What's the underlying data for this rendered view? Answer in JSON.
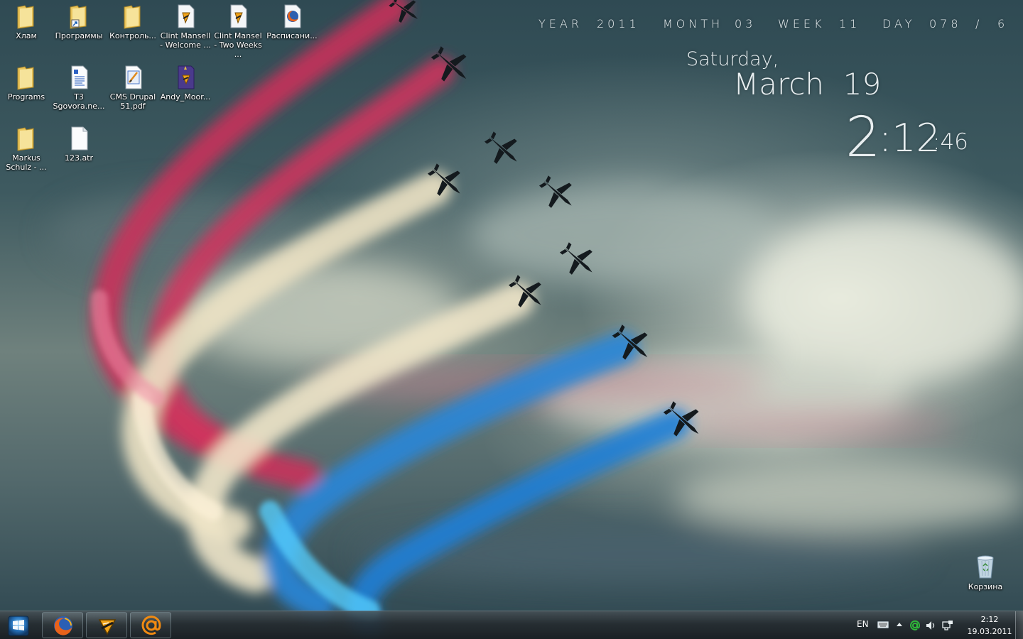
{
  "desktop": {
    "icons": [
      {
        "label": "Хлам",
        "icon": "folder-icon"
      },
      {
        "label": "Программы",
        "icon": "folder-shortcut-icon"
      },
      {
        "label": "Контроль...",
        "icon": "folder-icon"
      },
      {
        "label": "Clint Mansell - Welcome ...",
        "icon": "winamp-file-icon"
      },
      {
        "label": "Clint Mansel - Two Weeks ...",
        "icon": "winamp-file-icon"
      },
      {
        "label": "Расписани...",
        "icon": "firefox-file-icon"
      },
      {
        "label": "Programs",
        "icon": "folder-icon"
      },
      {
        "label": "T3 Sgovora.ne...",
        "icon": "document-icon"
      },
      {
        "label": "CMS Drupal 51.pdf",
        "icon": "pdf-icon"
      },
      {
        "label": "Andy_Moor...",
        "icon": "playlist-icon"
      },
      {
        "label": "Markus Schulz - ...",
        "icon": "folder-icon"
      },
      {
        "label": "123.atr",
        "icon": "blank-file-icon"
      }
    ],
    "recycle_bin": {
      "label": "Корзина",
      "icon": "recycle-bin-icon"
    }
  },
  "clock_widget": {
    "year_label": "YEAR",
    "year": "2011",
    "month_label": "MONTH",
    "month": "03",
    "week_label": "WEEK",
    "week": "11",
    "day_label": "DAY",
    "day_of_year": "078",
    "separator": "/",
    "day_of_week_num": "6",
    "weekday": "Saturday,",
    "month_day": "March  19",
    "hour": "2",
    "minutes": ":12",
    "seconds": ":46"
  },
  "taskbar": {
    "start_icon": "windows-logo-icon",
    "pinned": [
      {
        "name": "Firefox",
        "icon": "firefox-icon"
      },
      {
        "name": "Winamp",
        "icon": "winamp-icon"
      },
      {
        "name": "Mail.Ru Agent",
        "icon": "mail-at-icon"
      }
    ],
    "tray": {
      "language": "EN",
      "time": "2:12",
      "date": "19.03.2011"
    }
  },
  "colors": {
    "taskbar_bg": "#262d31",
    "clock_text": "#e8eef0",
    "smoke_red": "#d2325e",
    "smoke_white": "#efe6c8",
    "smoke_blue": "#1f7fd6"
  }
}
